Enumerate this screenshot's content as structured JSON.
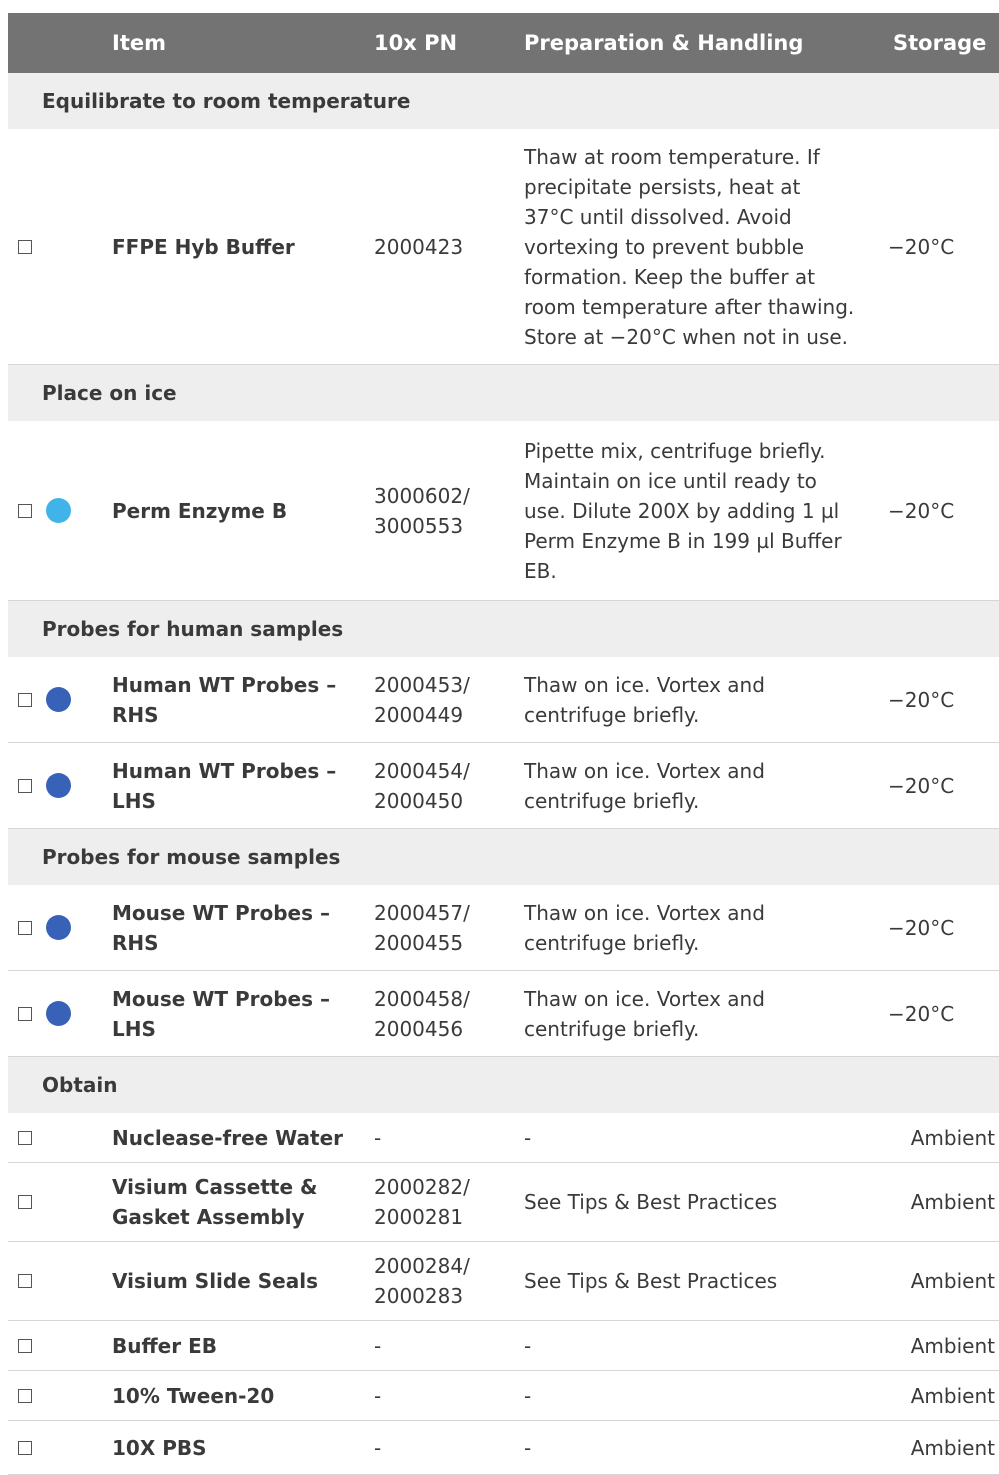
{
  "header": {
    "item": "Item",
    "pn": "10x PN",
    "prep": "Preparation &  Handling",
    "storage": "Storage"
  },
  "colors": {
    "header_bg": "#737373",
    "section_bg": "#eeeeee",
    "dot_light_blue": "#40b4e8",
    "dot_dark_blue": "#3762b8"
  },
  "sections": [
    {
      "title": "Equilibrate to room temperature",
      "items": [
        {
          "name": "FFPE Hyb Buffer",
          "pn": "2000423",
          "prep": "Thaw at room temperature. If\nprecipitate persists, heat at\n37°C until dissolved. Avoid\nvortexing to prevent bubble\nformation. Keep the buffer at\nroom temperature after thawing.\nStore at −20°C when not in use.",
          "storage": "−20°C",
          "dot": ""
        }
      ]
    },
    {
      "title": "Place on ice",
      "items": [
        {
          "name": "Perm Enzyme B",
          "pn": "3000602/\n3000553",
          "prep": "Pipette mix, centrifuge briefly.\nMaintain on ice until ready to\nuse. Dilute 200X by adding 1 µl\nPerm Enzyme B in 199 µl Buffer\nEB.",
          "storage": "−20°C",
          "dot": "light-blue"
        }
      ]
    },
    {
      "title": "Probes for human samples",
      "items": [
        {
          "name": "Human WT Probes –\nRHS",
          "pn": "2000453/\n2000449",
          "prep": "Thaw on ice.  Vortex and\ncentrifuge briefly.",
          "storage": "−20°C",
          "dot": "dark-blue"
        },
        {
          "name": "Human WT Probes –\nLHS",
          "pn": "2000454/\n2000450",
          "prep": "Thaw on ice.  Vortex and\ncentrifuge briefly.",
          "storage": "−20°C",
          "dot": "dark-blue"
        }
      ]
    },
    {
      "title": "Probes for mouse samples",
      "items": [
        {
          "name": "Mouse WT Probes –\nRHS",
          "pn": "2000457/\n2000455",
          "prep": "Thaw on ice.  Vortex and\ncentrifuge briefly.",
          "storage": "−20°C",
          "dot": "dark-blue"
        },
        {
          "name": "Mouse WT Probes –\nLHS",
          "pn": "2000458/\n2000456",
          "prep": "Thaw on ice.  Vortex and\ncentrifuge briefly.",
          "storage": "−20°C",
          "dot": "dark-blue"
        }
      ]
    },
    {
      "title": "Obtain",
      "items": [
        {
          "name": "Nuclease-free Water",
          "pn": "-",
          "prep": "-",
          "storage": "Ambient",
          "dot": ""
        },
        {
          "name": "Visium Cassette &\nGasket Assembly",
          "pn": "2000282/\n2000281",
          "prep": "See Tips & Best Practices",
          "storage": "Ambient",
          "dot": ""
        },
        {
          "name": "Visium Slide Seals",
          "pn": "2000284/\n2000283",
          "prep": "See Tips & Best Practices",
          "storage": "Ambient",
          "dot": ""
        },
        {
          "name": "Buffer EB",
          "pn": "-",
          "prep": "-",
          "storage": "Ambient",
          "dot": ""
        },
        {
          "name": "10% Tween-20",
          "pn": "-",
          "prep": "-",
          "storage": "Ambient",
          "dot": ""
        },
        {
          "name": "10X PBS",
          "pn": "-",
          "prep": "-",
          "storage": "Ambient",
          "dot": ""
        }
      ]
    }
  ]
}
